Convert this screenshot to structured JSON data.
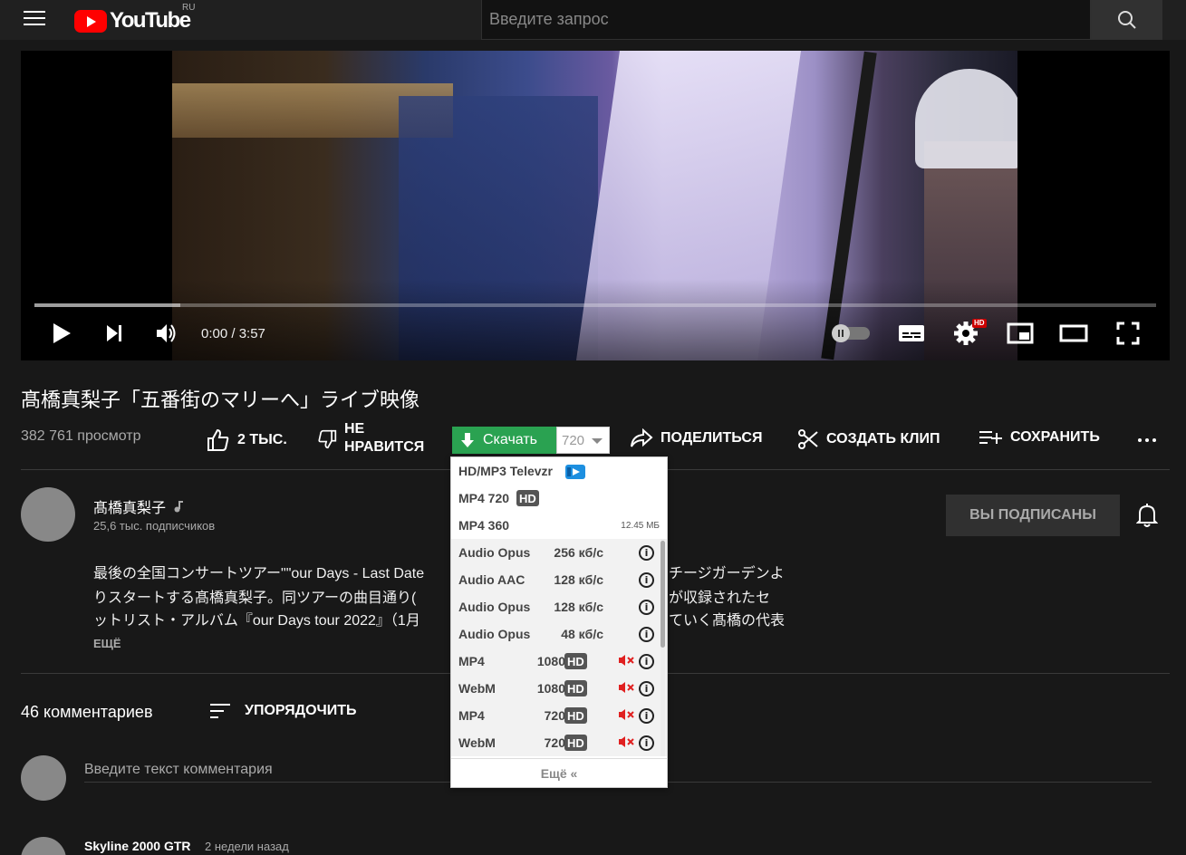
{
  "header": {
    "logo_text": "YouTube",
    "region": "RU",
    "search_placeholder": "Введите запрос"
  },
  "player": {
    "time": "0:00 / 3:57",
    "progress_fraction": 0.13,
    "settings_badge": "HD"
  },
  "video": {
    "title": "髙橋真梨子「五番街のマリーへ」ライブ映像",
    "views": "382 761 просмотр",
    "like_label": "2 ТЫС.",
    "dislike_line1": "НЕ",
    "dislike_line2": "НРАВИТСЯ",
    "share_label": "ПОДЕЛИТЬСЯ",
    "clip_label": "СОЗДАТЬ КЛИП",
    "save_label": "СОХРАНИТЬ"
  },
  "downloader": {
    "button_label": "Скачать",
    "selected_quality": "720",
    "accent_color": "#2aa251",
    "top_items": [
      {
        "label": "HD/MP3 Televzr"
      },
      {
        "label": "MP4 720",
        "badge": "HD"
      },
      {
        "label": "MP4 360",
        "size": "12.45 МБ"
      }
    ],
    "audio_items": [
      {
        "format": "Audio Opus",
        "bitrate": "256 кб/с"
      },
      {
        "format": "Audio AAC",
        "bitrate": "128 кб/с"
      },
      {
        "format": "Audio Opus",
        "bitrate": "128 кб/с"
      },
      {
        "format": "Audio Opus",
        "bitrate": "48 кб/с"
      }
    ],
    "video_items": [
      {
        "format": "MP4",
        "res": "1080",
        "badge": "HD"
      },
      {
        "format": "WebM",
        "res": "1080",
        "badge": "HD"
      },
      {
        "format": "MP4",
        "res": "720",
        "badge": "HD"
      },
      {
        "format": "WebM",
        "res": "720",
        "badge": "HD"
      }
    ],
    "more_label": "Ещё «"
  },
  "channel": {
    "name": "髙橋真梨子",
    "subscribers": "25,6 тыс. подписчиков",
    "subscribe_label": "ВЫ ПОДПИСАНЫ"
  },
  "description": {
    "line1_left": "最後の全国コンサートツアー\"\"our Days - Last Date",
    "line1_right": "チージガーデンよ",
    "line2_left": "りスタートする髙橋真梨子。同ツアーの曲目通り(",
    "line2_right": "が収録されたセ",
    "line3_left": "ットリスト・アルバム『our Days tour 2022』（1月",
    "line3_right": "ていく髙橋の代表",
    "more_label": "ЕЩЁ"
  },
  "comments": {
    "count_label": "46 комментариев",
    "sort_label": "УПОРЯДОЧИТЬ",
    "input_placeholder": "Введите текст комментария",
    "first_author": "Skyline 2000 GTR",
    "first_time": "2 недели назад"
  }
}
